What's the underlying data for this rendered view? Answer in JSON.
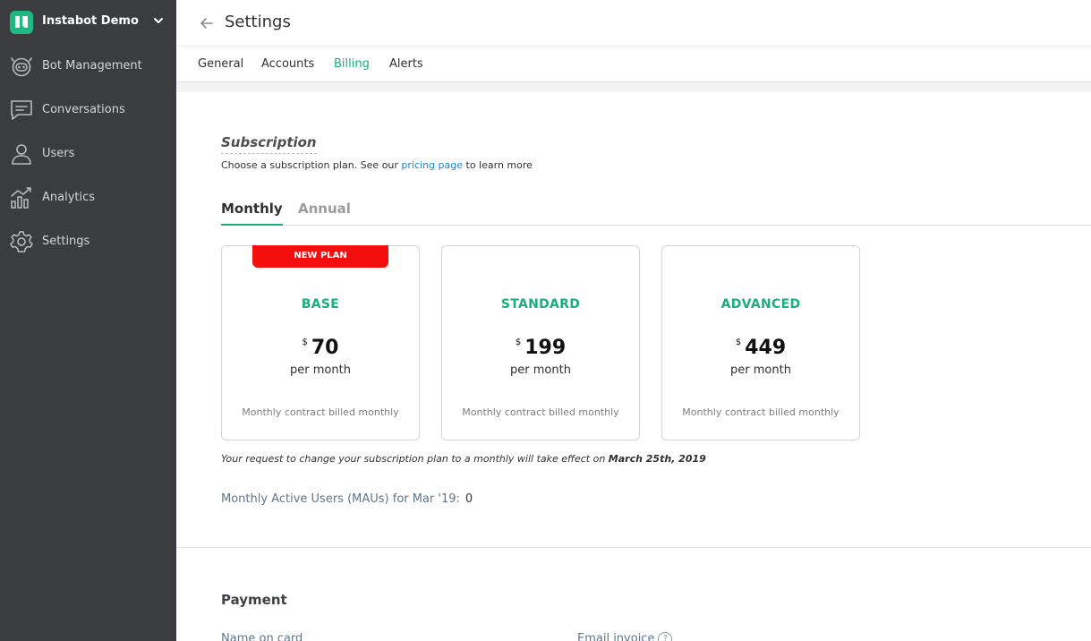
{
  "sidebar": {
    "workspace": "Instabot Demo",
    "items": [
      {
        "label": "Bot Management",
        "icon": "robot-icon"
      },
      {
        "label": "Conversations",
        "icon": "chat-icon"
      },
      {
        "label": "Users",
        "icon": "user-icon"
      },
      {
        "label": "Analytics",
        "icon": "analytics-icon"
      },
      {
        "label": "Settings",
        "icon": "gear-icon"
      }
    ]
  },
  "header": {
    "title": "Settings",
    "tabs": [
      {
        "label": "General",
        "active": false
      },
      {
        "label": "Accounts",
        "active": false
      },
      {
        "label": "Billing",
        "active": true
      },
      {
        "label": "Alerts",
        "active": false
      }
    ]
  },
  "subscription": {
    "title": "Subscription",
    "desc_before": "Choose a subscription plan. See our ",
    "desc_link": "pricing page",
    "desc_after": " to learn more",
    "period_tabs": [
      {
        "label": "Monthly",
        "active": true
      },
      {
        "label": "Annual",
        "active": false
      }
    ],
    "plans": [
      {
        "badge": "NEW PLAN",
        "name": "BASE",
        "currency": "$",
        "price": "70",
        "period": "per month",
        "contract": "Monthly contract billed monthly"
      },
      {
        "name": "STANDARD",
        "currency": "$",
        "price": "199",
        "period": "per month",
        "contract": "Monthly contract billed monthly"
      },
      {
        "name": "ADVANCED",
        "currency": "$",
        "price": "449",
        "period": "per month",
        "contract": "Monthly contract billed monthly"
      }
    ],
    "change_note": "Your request to change your subscription plan to a monthly will take effect on",
    "change_date": "March 25th, 2019",
    "mau_label": "Monthly Active Users (MAUs) for Mar '19:",
    "mau_value": "0"
  },
  "payment": {
    "title": "Payment",
    "name_on_card_label": "Name on card",
    "email_invoice_label": "Email invoice",
    "help_glyph": "?"
  },
  "colors": {
    "sidebar_bg": "#3a3c3f",
    "accent": "#1cae7c",
    "badge": "#f50e0e",
    "link": "#1d87c9"
  }
}
